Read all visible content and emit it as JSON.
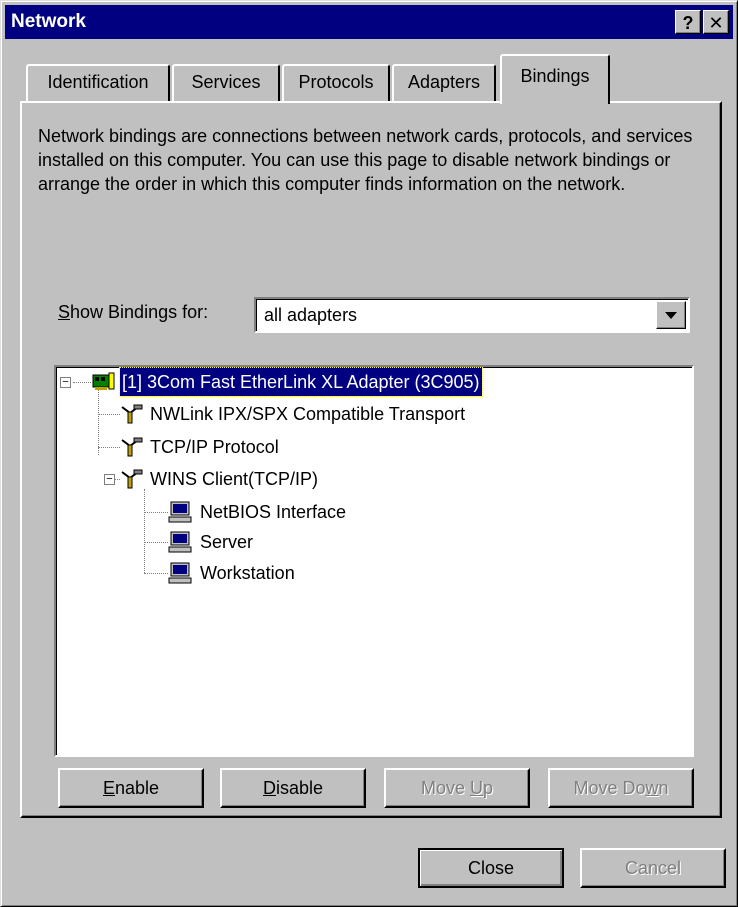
{
  "window": {
    "title": "Network"
  },
  "titlebar_buttons": {
    "help": "?",
    "close": "✕"
  },
  "tabs": [
    {
      "label": "Identification",
      "active": false
    },
    {
      "label": "Services",
      "active": false
    },
    {
      "label": "Protocols",
      "active": false
    },
    {
      "label": "Adapters",
      "active": false
    },
    {
      "label": "Bindings",
      "active": true
    }
  ],
  "bindings": {
    "description": "Network bindings are connections between network cards, protocols, and services installed on this computer.  You can use this page to disable network bindings or arrange the order in which this computer finds information on the network.",
    "show_label_accel": "S",
    "show_label_rest": "how Bindings for:",
    "show_value": "all adapters",
    "tree": {
      "adapter": "[1] 3Com Fast EtherLink XL Adapter (3C905)",
      "protocols": [
        "NWLink IPX/SPX Compatible Transport",
        "TCP/IP Protocol",
        "WINS Client(TCP/IP)"
      ],
      "services": [
        "NetBIOS Interface",
        "Server",
        "Workstation"
      ]
    },
    "buttons": {
      "enable": {
        "accel": "E",
        "rest": "nable"
      },
      "disable": {
        "accel": "D",
        "rest": "isable"
      },
      "move_up": {
        "pre": "Move ",
        "accel": "U",
        "rest": "p"
      },
      "move_down": {
        "pre": "Move Do",
        "accel": "w",
        "rest": "n"
      }
    }
  },
  "footer": {
    "close": "Close",
    "cancel": "Cancel"
  },
  "colors": {
    "titlebar": "#000080",
    "face": "#c0c0c0",
    "selection": "#000080"
  }
}
